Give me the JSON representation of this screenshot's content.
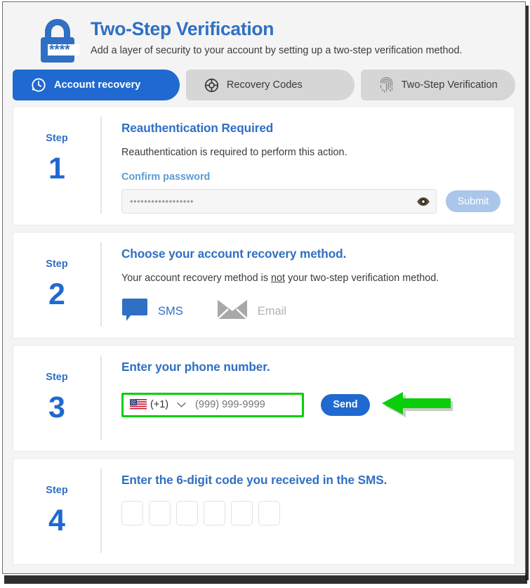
{
  "header": {
    "icon": "padlock-asterisks-icon",
    "title": "Two-Step Verification",
    "subtitle": "Add a layer of security to your account by setting up a two-step verification method.",
    "title_color": "#2f6fc4"
  },
  "tabs": [
    {
      "label": "Account recovery",
      "icon": "account-recovery-icon",
      "active": true
    },
    {
      "label": "Recovery Codes",
      "icon": "lifebuoy-icon",
      "active": false
    },
    {
      "label": "Two-Step Verification",
      "icon": "fingerprint-icon",
      "active": false
    }
  ],
  "steps": [
    {
      "step_word": "Step",
      "step_number": "1",
      "title": "Reauthentication Required",
      "description": "Reauthentication is required to perform this action.",
      "field_label": "Confirm password",
      "password_value": "••••••••••••••••••",
      "password_placeholder": "",
      "eye_icon": "eye-icon",
      "submit_label": "Submit"
    },
    {
      "step_word": "Step",
      "step_number": "2",
      "title": "Choose your account recovery method.",
      "description_pre": "Your account recovery method is ",
      "description_underlined": "not",
      "description_post": " your two-step verification method.",
      "methods": [
        {
          "label": "SMS",
          "icon": "speech-bubble-icon",
          "selected": true,
          "color": "#2f6fc4"
        },
        {
          "label": "Email",
          "icon": "envelope-icon",
          "selected": false,
          "color": "#b2b2b2"
        }
      ]
    },
    {
      "step_word": "Step",
      "step_number": "3",
      "title": "Enter your phone number.",
      "country_flag": "us-flag-icon",
      "country_code": "(+1)",
      "dropdown_icon": "chevron-down-icon",
      "phone_placeholder": "(999) 999-9999",
      "phone_value": "",
      "send_label": "Send",
      "highlight_color": "#0ace0a",
      "annotation_icon": "green-left-arrow-annotation",
      "annotation_color": "#0ace0a"
    },
    {
      "step_word": "Step",
      "step_number": "4",
      "title": "Enter the 6-digit code you received in the SMS.",
      "code_digits": [
        "",
        "",
        "",
        "",
        "",
        ""
      ]
    }
  ],
  "colors": {
    "brand_blue": "#1f69d0",
    "title_blue": "#2f6fc4",
    "tab_inactive_bg": "#d6d6d6",
    "page_bg": "#f4f4f4",
    "card_bg": "#ffffff",
    "disabled_button": "#aac6ea"
  }
}
